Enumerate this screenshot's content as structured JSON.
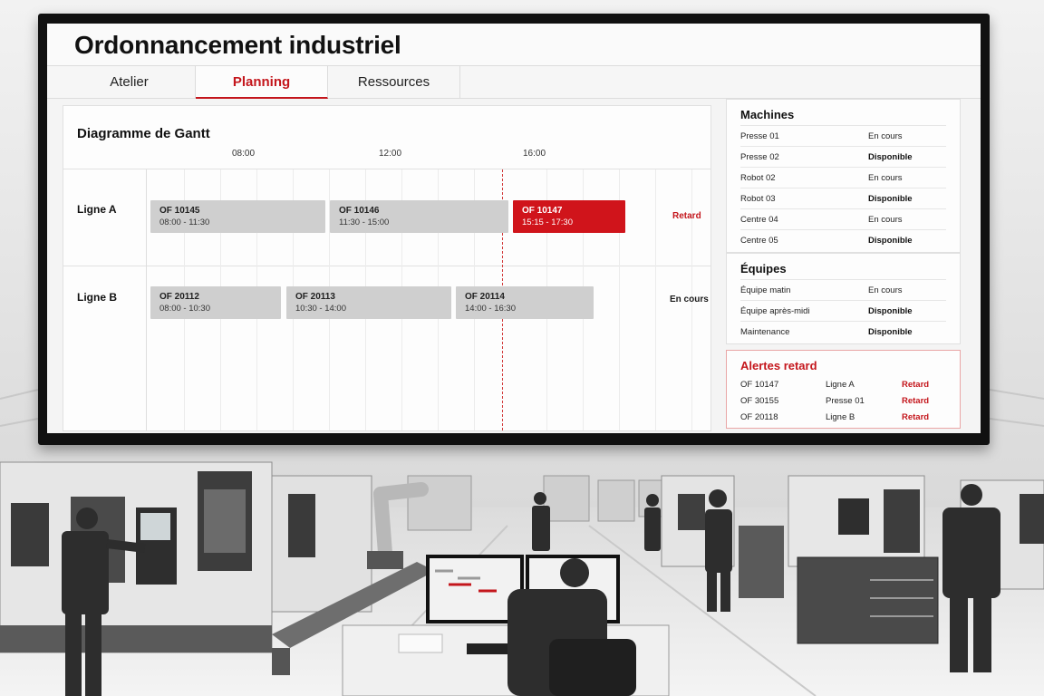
{
  "app": {
    "title": "Ordonnancement industriel"
  },
  "tabs": [
    {
      "label": "Atelier",
      "active": false
    },
    {
      "label": "Planning",
      "active": true
    },
    {
      "label": "Ressources",
      "active": false
    }
  ],
  "gantt": {
    "title": "Diagramme de Gantt",
    "times": [
      "08:00",
      "12:00",
      "16:00"
    ],
    "rows": [
      {
        "label": "Ligne A",
        "status": "Retard",
        "status_color": "#c4161c",
        "orders": [
          {
            "id": "OF 10145",
            "time": "08:00 - 11:30",
            "late": false
          },
          {
            "id": "OF 10146",
            "time": "11:30 - 15:00",
            "late": false
          },
          {
            "id": "OF 10147",
            "time": "15:15 - 17:30",
            "late": true
          }
        ]
      },
      {
        "label": "Ligne B",
        "status": "En cours",
        "status_color": "#111111",
        "orders": [
          {
            "id": "OF 20112",
            "time": "08:00 - 10:30",
            "late": false
          },
          {
            "id": "OF 20113",
            "time": "10:30 - 14:00",
            "late": false
          },
          {
            "id": "OF 20114",
            "time": "14:00 - 16:30",
            "late": false
          }
        ]
      }
    ]
  },
  "machines": {
    "title": "Machines",
    "items": [
      {
        "name": "Presse 01",
        "status": "En cours"
      },
      {
        "name": "Presse 02",
        "status": "Disponible"
      },
      {
        "name": "Robot 02",
        "status": "En cours"
      },
      {
        "name": "Robot 03",
        "status": "Disponible"
      },
      {
        "name": "Centre 04",
        "status": "En cours"
      },
      {
        "name": "Centre 05",
        "status": "Disponible"
      }
    ]
  },
  "teams": {
    "title": "Équipes",
    "items": [
      {
        "name": "Équipe matin",
        "status": "En cours"
      },
      {
        "name": "Équipe après-midi",
        "status": "Disponible"
      },
      {
        "name": "Maintenance",
        "status": "Disponible"
      }
    ]
  },
  "alerts": {
    "title": "Alertes retard",
    "items": [
      {
        "of": "OF 10147",
        "where": "Ligne A",
        "status": "Retard"
      },
      {
        "of": "OF 30155",
        "where": "Presse 01",
        "status": "Retard"
      },
      {
        "of": "OF 20118",
        "where": "Ligne B",
        "status": "Retard"
      }
    ]
  },
  "colors": {
    "accent": "#c4161c",
    "late_bar": "#d0141b",
    "bar": "#cfcfcf"
  }
}
